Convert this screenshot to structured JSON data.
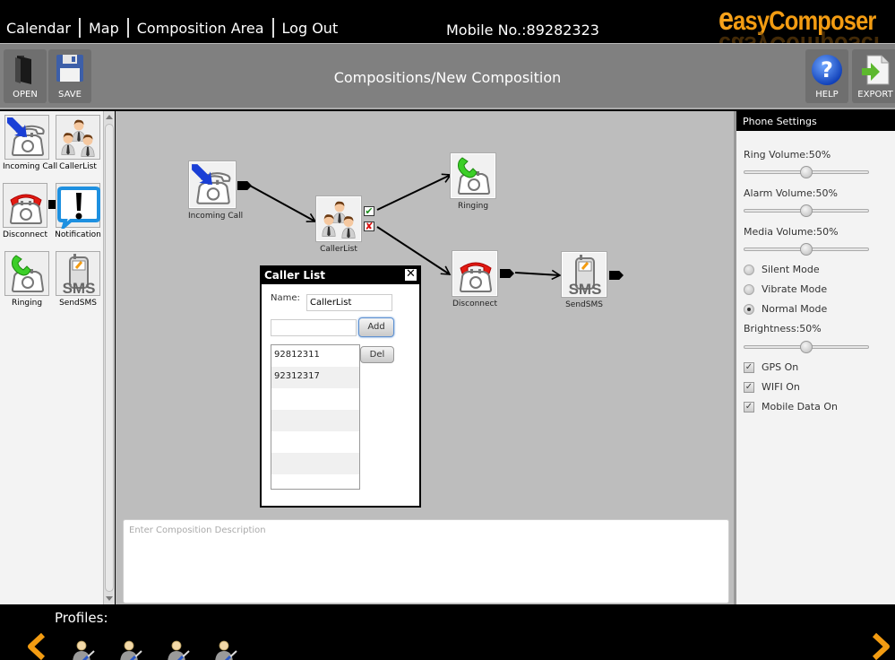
{
  "topbar": {
    "nav": [
      "Calendar",
      "Map",
      "Composition Area",
      "Log Out"
    ],
    "mobile": "Mobile No.:89282323",
    "logo_initial": "e",
    "logo_rest": "asyComposer"
  },
  "toolbar": {
    "open_label": "OPEN",
    "save_label": "SAVE",
    "title": "Compositions/New Composition",
    "help_label": "HELP",
    "export_label": "EXPORT"
  },
  "palette": {
    "items": [
      {
        "label": "Incoming Call",
        "icon": "incoming-call-icon"
      },
      {
        "label": "CallerList",
        "icon": "caller-list-icon"
      },
      {
        "label": "Disconnect",
        "icon": "disconnect-icon"
      },
      {
        "label": "Notification",
        "icon": "notification-icon"
      },
      {
        "label": "Ringing",
        "icon": "ringing-icon"
      },
      {
        "label": "SendSMS",
        "icon": "send-sms-icon"
      }
    ]
  },
  "canvas": {
    "nodes": [
      {
        "label": "Incoming Call",
        "icon": "incoming-call-icon"
      },
      {
        "label": "CallerList",
        "icon": "caller-list-icon"
      },
      {
        "label": "Ringing",
        "icon": "ringing-icon"
      },
      {
        "label": "Disconnect",
        "icon": "disconnect-icon"
      },
      {
        "label": "SendSMS",
        "icon": "send-sms-icon"
      }
    ],
    "connections": [
      {
        "from": "Incoming Call",
        "to": "CallerList"
      },
      {
        "from": "CallerList (match)",
        "to": "Ringing"
      },
      {
        "from": "CallerList (no match)",
        "to": "Disconnect"
      },
      {
        "from": "Disconnect",
        "to": "SendSMS"
      }
    ],
    "port_yes": "✔",
    "port_no": "✘"
  },
  "description": {
    "placeholder": "Enter Composition Description",
    "value": ""
  },
  "dialog": {
    "title": "Caller List",
    "close": "✕",
    "name_label": "Name:",
    "name_value": "CallerList",
    "number_value": "",
    "add_label": "Add",
    "del_label": "Del",
    "numbers": [
      "92812311",
      "92312317",
      "",
      "",
      "",
      "",
      ""
    ]
  },
  "settings": {
    "title": "Phone Settings",
    "ring_volume_label": "Ring Volume:50%",
    "ring_volume": 50,
    "alarm_volume_label": "Alarm Volume:50%",
    "alarm_volume": 50,
    "media_volume_label": "Media Volume:50%",
    "media_volume": 50,
    "modes": [
      {
        "label": "Silent Mode",
        "selected": false
      },
      {
        "label": "Vibrate Mode",
        "selected": false
      },
      {
        "label": "Normal Mode",
        "selected": true
      }
    ],
    "brightness_label": "Brightness:50%",
    "brightness": 50,
    "toggles": [
      {
        "label": "GPS On",
        "checked": true
      },
      {
        "label": "WIFI On",
        "checked": true
      },
      {
        "label": "Mobile Data On",
        "checked": true
      }
    ],
    "check_glyph": "✓"
  },
  "bottombar": {
    "profiles_label": "Profiles:",
    "profile_count": 4
  },
  "colors": {
    "accent_orange": "#f39c12",
    "canvas_bg": "#bdbdbd",
    "toolbar_bg": "#808080",
    "check_green": "#1e8f1e",
    "cross_red": "#d11"
  }
}
